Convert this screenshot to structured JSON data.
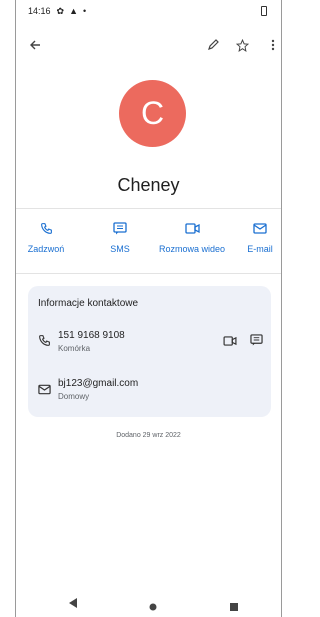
{
  "status_bar": {
    "time": "14:16"
  },
  "app_bar": {
    "back_icon": "arrow-left-icon",
    "edit_icon": "pencil-icon",
    "favorite_icon": "star-outline-icon",
    "more_icon": "more-vert-icon"
  },
  "contact": {
    "initial": "C",
    "name": "Cheney",
    "avatar_color": "#ec6a5e"
  },
  "actions": [
    {
      "label": "Zadzwoń",
      "icon": "phone-icon"
    },
    {
      "label": "SMS",
      "icon": "message-icon"
    },
    {
      "label": "Rozmowa wideo",
      "icon": "video-icon"
    },
    {
      "label": "E-mail",
      "icon": "mail-icon"
    }
  ],
  "info_card": {
    "title": "Informacje kontaktowe",
    "phone": {
      "number": "151 9168 9108",
      "type": "Komórka"
    },
    "email": {
      "address": "bj123@gmail.com",
      "type": "Domowy"
    }
  },
  "added_note": "Dodano 29 wrz 2022",
  "accent_color": "#1a6fd1"
}
